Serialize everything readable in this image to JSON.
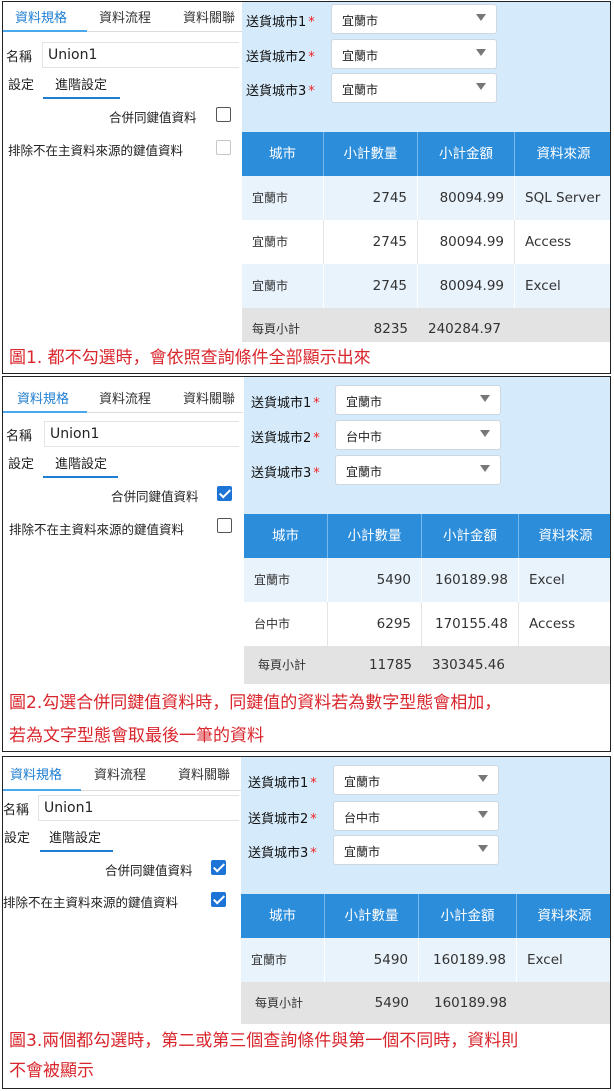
{
  "panels": [
    {
      "tabs": [
        "資料規格",
        "資料流程",
        "資料關聯"
      ],
      "name_label": "名稱",
      "name_value": "Union1",
      "subtabs": [
        "設定",
        "進階設定"
      ],
      "options": [
        {
          "label": "合併同鍵值資料",
          "checked": false,
          "disabled": false
        },
        {
          "label": "排除不在主資料來源的鍵值資料",
          "checked": false,
          "disabled": true
        }
      ],
      "queries": [
        {
          "label": "送貨城市1",
          "value": "宜蘭市"
        },
        {
          "label": "送貨城市2",
          "value": "宜蘭市"
        },
        {
          "label": "送貨城市3",
          "value": "宜蘭市"
        }
      ],
      "table": {
        "headers": [
          "城市",
          "小計數量",
          "小計金額",
          "資料來源"
        ],
        "rows": [
          {
            "city": "宜蘭市",
            "qty": "2745",
            "amount": "80094.99",
            "source": "SQL Server"
          },
          {
            "city": "宜蘭市",
            "qty": "2745",
            "amount": "80094.99",
            "source": "Access"
          },
          {
            "city": "宜蘭市",
            "qty": "2745",
            "amount": "80094.99",
            "source": "Excel"
          }
        ],
        "total": {
          "label": "每頁小計",
          "qty": "8235",
          "amount": "240284.97"
        }
      },
      "caption": [
        "圖1. 都不勾選時，會依照查詢條件全部顯示出來"
      ]
    },
    {
      "tabs": [
        "資料規格",
        "資料流程",
        "資料關聯"
      ],
      "name_label": "名稱",
      "name_value": "Union1",
      "subtabs": [
        "設定",
        "進階設定"
      ],
      "options": [
        {
          "label": "合併同鍵值資料",
          "checked": true,
          "disabled": false
        },
        {
          "label": "排除不在主資料來源的鍵值資料",
          "checked": false,
          "disabled": false
        }
      ],
      "queries": [
        {
          "label": "送貨城市1",
          "value": "宜蘭市"
        },
        {
          "label": "送貨城市2",
          "value": "台中市"
        },
        {
          "label": "送貨城市3",
          "value": "宜蘭市"
        }
      ],
      "table": {
        "headers": [
          "城市",
          "小計數量",
          "小計金額",
          "資料來源"
        ],
        "rows": [
          {
            "city": "宜蘭市",
            "qty": "5490",
            "amount": "160189.98",
            "source": "Excel"
          },
          {
            "city": "台中市",
            "qty": "6295",
            "amount": "170155.48",
            "source": "Access"
          }
        ],
        "total": {
          "label": "每頁小計",
          "qty": "11785",
          "amount": "330345.46"
        }
      },
      "caption": [
        "圖2.勾選合併同鍵值資料時，同鍵值的資料若為數字型態會相加，",
        "若為文字型態會取最後一筆的資料"
      ]
    },
    {
      "tabs": [
        "資料規格",
        "資料流程",
        "資料關聯"
      ],
      "name_label": "名稱",
      "name_value": "Union1",
      "subtabs": [
        "設定",
        "進階設定"
      ],
      "options": [
        {
          "label": "合併同鍵值資料",
          "checked": true,
          "disabled": false
        },
        {
          "label": "排除不在主資料來源的鍵值資料",
          "checked": true,
          "disabled": false
        }
      ],
      "queries": [
        {
          "label": "送貨城市1",
          "value": "宜蘭市"
        },
        {
          "label": "送貨城市2",
          "value": "台中市"
        },
        {
          "label": "送貨城市3",
          "value": "宜蘭市"
        }
      ],
      "table": {
        "headers": [
          "城市",
          "小計數量",
          "小計金額",
          "資料來源"
        ],
        "rows": [
          {
            "city": "宜蘭市",
            "qty": "5490",
            "amount": "160189.98",
            "source": "Excel"
          }
        ],
        "total": {
          "label": "每頁小計",
          "qty": "5490",
          "amount": "160189.98"
        }
      },
      "caption": [
        "圖3.兩個都勾選時，第二或第三個查詢條件與第一個不同時，資料則",
        "不會被顯示"
      ]
    }
  ]
}
